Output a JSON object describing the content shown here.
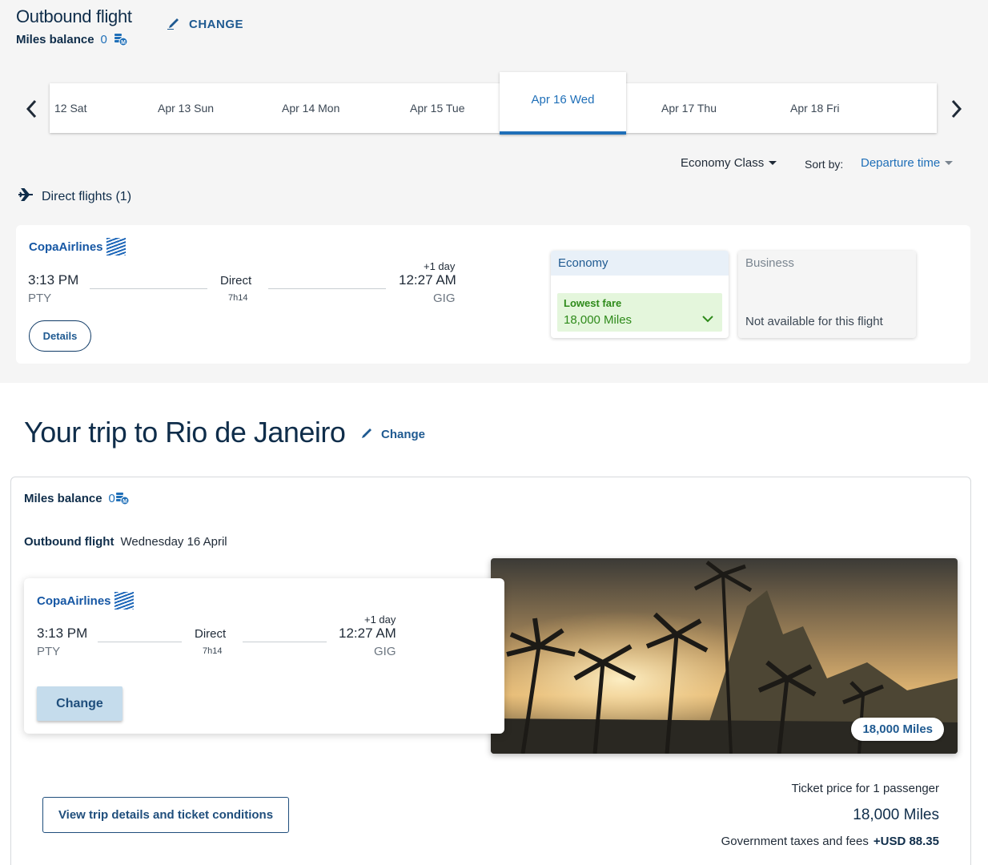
{
  "outbound": {
    "title": "Outbound flight",
    "change_label": "CHANGE",
    "miles_label": "Miles balance",
    "miles_value": "0"
  },
  "dates": {
    "items": [
      {
        "label": "12 Sat"
      },
      {
        "label": "Apr 13 Sun"
      },
      {
        "label": "Apr 14 Mon"
      },
      {
        "label": "Apr 15 Tue"
      },
      {
        "label": "Apr 16 Wed",
        "selected": true
      },
      {
        "label": "Apr 17 Thu"
      },
      {
        "label": "Apr 18 Fri"
      }
    ]
  },
  "filters": {
    "cabin": "Economy Class",
    "sort_label": "Sort by:",
    "sort_value": "Departure time"
  },
  "section_heading": "Direct flights (1)",
  "flight": {
    "airline": "CopaAirlines",
    "depart_time": "3:13 PM",
    "depart_code": "PTY",
    "stops": "Direct",
    "duration": "7h14",
    "day_offset": "+1 day",
    "arrive_time": "12:27 AM",
    "arrive_code": "GIG",
    "details_label": "Details"
  },
  "fares": {
    "economy": {
      "label": "Economy",
      "badge": "Lowest fare",
      "price": "18,000 Miles"
    },
    "business": {
      "label": "Business",
      "note": "Not available for this flight"
    }
  },
  "trip": {
    "title": "Your trip to Rio de Janeiro",
    "change_label": "Change",
    "miles_label": "Miles balance",
    "miles_value": "0",
    "outbound_label": "Outbound flight",
    "outbound_date": "Wednesday 16 April",
    "change_button": "Change",
    "photo_price": "18,000 Miles",
    "view_details_button": "View trip details and ticket conditions",
    "ticket_price_label": "Ticket price for 1 passenger",
    "ticket_price": "18,000 Miles",
    "taxes_label": "Government taxes and fees",
    "taxes_value": "+USD 88.35"
  },
  "colors": {
    "brand_blue": "#1f6fb8",
    "dark_navy": "#0f2d4a",
    "lowest_fare_bg": "#e4f6dc",
    "lowest_fare_text": "#2e8a1a"
  },
  "icons": {
    "edit": "pencil-icon",
    "miles": "miles-coin-icon",
    "prev": "chevron-left-icon",
    "next": "chevron-right-icon",
    "plane": "airplane-icon",
    "expand": "chevron-down-icon"
  }
}
